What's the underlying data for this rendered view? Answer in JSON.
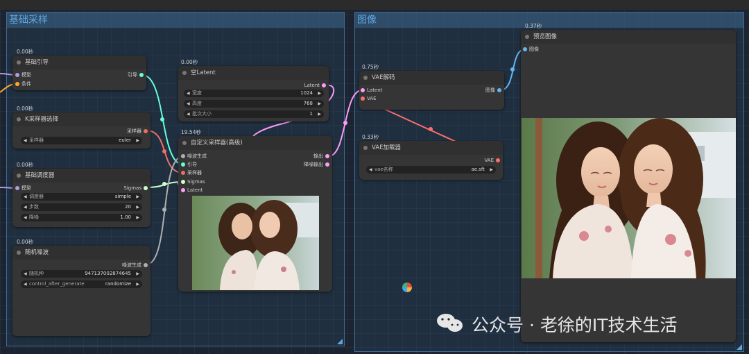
{
  "groups": {
    "sampling": {
      "title": "基础采样"
    },
    "image": {
      "title": "图像"
    }
  },
  "nodes": {
    "basic_guider": {
      "timing": "0.00秒",
      "title": "基础引导",
      "inputs": [
        "模型",
        "条件"
      ],
      "outputs": [
        "引导"
      ]
    },
    "ksampler_select": {
      "timing": "0.00秒",
      "title": "K采样器选择",
      "outputs": [
        "采样器"
      ],
      "widgets": [
        {
          "label": "采样器",
          "value": "euler"
        }
      ]
    },
    "basic_scheduler": {
      "timing": "0.00秒",
      "title": "基础调度器",
      "inputs": [
        "模型"
      ],
      "outputs": [
        "Sigmas"
      ],
      "widgets": [
        {
          "label": "调度器",
          "value": "simple"
        },
        {
          "label": "步数",
          "value": "20"
        },
        {
          "label": "降噪",
          "value": "1.00"
        }
      ]
    },
    "random_noise": {
      "timing": "0.00秒",
      "title": "随机噪波",
      "outputs": [
        "噪波生成"
      ],
      "widgets": [
        {
          "label": "随机种",
          "value": "947137002874645"
        },
        {
          "label": "control_after_generate",
          "value": "randomize"
        }
      ]
    },
    "empty_latent": {
      "timing": "0.00秒",
      "title": "空Latent",
      "outputs": [
        "Latent"
      ],
      "widgets": [
        {
          "label": "宽度",
          "value": "1024"
        },
        {
          "label": "高度",
          "value": "768"
        },
        {
          "label": "批次大小",
          "value": "1"
        }
      ]
    },
    "custom_sampler": {
      "timing": "19.54秒",
      "title": "自定义采样器(高级)",
      "inputs": [
        "噪波生成",
        "引导",
        "采样器",
        "Sigmas",
        "Latent"
      ],
      "outputs": [
        "输出",
        "降噪输出"
      ]
    },
    "vae_decode": {
      "timing": "0.75秒",
      "title": "VAE解码",
      "inputs": [
        "Latent",
        "VAE"
      ],
      "outputs": [
        "图像"
      ]
    },
    "vae_loader": {
      "timing": "0.33秒",
      "title": "VAE加载器",
      "outputs": [
        "VAE"
      ],
      "widgets": [
        {
          "label": "vae名称",
          "value": "ae.sft"
        }
      ]
    },
    "preview_image": {
      "timing": "0.37秒",
      "title": "预览图像",
      "inputs": [
        "图像"
      ]
    }
  },
  "watermark": {
    "text": "公众号 · 老徐的IT技术生活"
  },
  "colors": {
    "model": "#b39ddb",
    "conditioning": "#ffa931",
    "guider": "#66ffd9",
    "sampler": "#ec7063",
    "sigmas": "#cdffcd",
    "latent": "#ff9cf9",
    "vae": "#ff6e6e",
    "image": "#64b5f6",
    "noise": "#b0b0b0",
    "group_title": "#5fa6de"
  }
}
